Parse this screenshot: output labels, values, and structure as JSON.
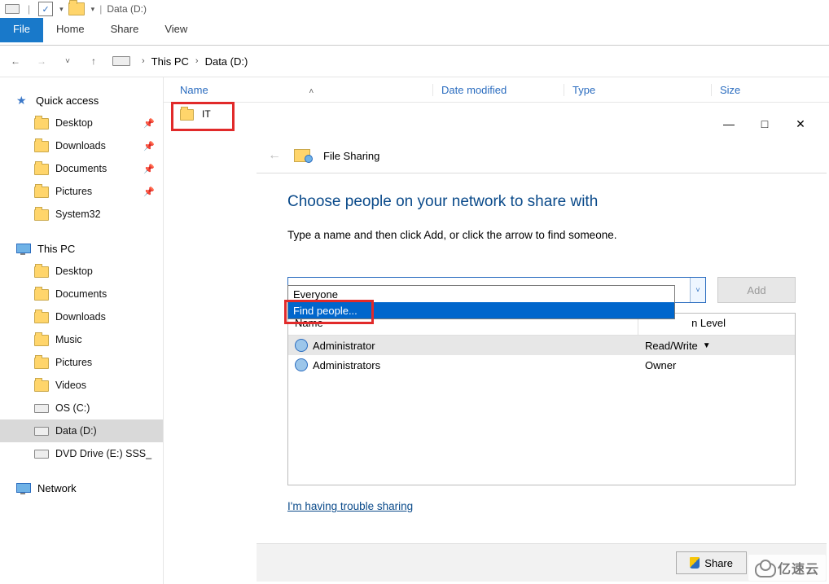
{
  "window": {
    "title": "Data (D:)"
  },
  "ribbon": {
    "file": "File",
    "home": "Home",
    "share": "Share",
    "view": "View"
  },
  "breadcrumb": {
    "root": "This PC",
    "current": "Data (D:)"
  },
  "nav": {
    "quick_access": "Quick access",
    "desktop": "Desktop",
    "downloads": "Downloads",
    "documents": "Documents",
    "pictures": "Pictures",
    "system32": "System32",
    "this_pc": "This PC",
    "pc_desktop": "Desktop",
    "pc_documents": "Documents",
    "pc_downloads": "Downloads",
    "pc_music": "Music",
    "pc_pictures": "Pictures",
    "pc_videos": "Videos",
    "os_c": "OS (C:)",
    "data_d": "Data (D:)",
    "dvd_e": "DVD Drive (E:) SSS_",
    "network": "Network"
  },
  "columns": {
    "name": "Name",
    "date": "Date modified",
    "type": "Type",
    "size": "Size"
  },
  "files": {
    "it": "IT"
  },
  "dialog": {
    "header": "File Sharing",
    "title": "Choose people on your network to share with",
    "subtitle": "Type a name and then click Add, or click the arrow to find someone.",
    "add": "Add",
    "dropdown": {
      "everyone": "Everyone",
      "find": "Find people..."
    },
    "table": {
      "col_name": "Name",
      "col_perm": "Permission Level",
      "row1_name": "Administrator",
      "row1_perm": "Read/Write",
      "row2_name": "Administrators",
      "row2_perm": "Owner"
    },
    "trouble": "I'm having trouble sharing",
    "share_btn": "Share"
  },
  "watermark": "亿速云"
}
